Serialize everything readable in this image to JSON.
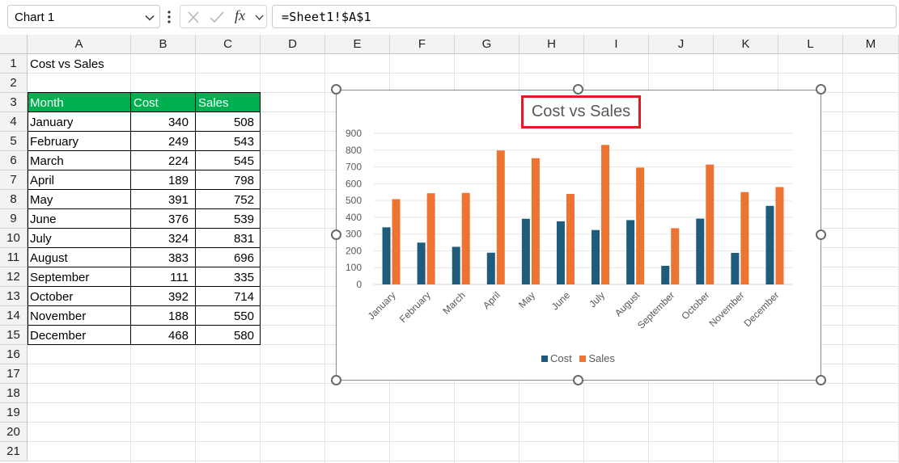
{
  "name_box": {
    "value": "Chart 1"
  },
  "formula_bar": {
    "formula": "=Sheet1!$A$1",
    "fx_label": "fx"
  },
  "columns": [
    "A",
    "B",
    "C",
    "D",
    "E",
    "F",
    "G",
    "H",
    "I",
    "J",
    "K",
    "L",
    "M"
  ],
  "rows": [
    "1",
    "2",
    "3",
    "4",
    "5",
    "6",
    "7",
    "8",
    "9",
    "10",
    "11",
    "12",
    "13",
    "14",
    "15",
    "16",
    "17",
    "18",
    "19",
    "20",
    "21"
  ],
  "sheet": {
    "a1": "Cost vs Sales",
    "header": {
      "month": "Month",
      "cost": "Cost",
      "sales": "Sales"
    },
    "data": [
      {
        "month": "January",
        "cost": "340",
        "sales": "508"
      },
      {
        "month": "February",
        "cost": "249",
        "sales": "543"
      },
      {
        "month": "March",
        "cost": "224",
        "sales": "545"
      },
      {
        "month": "April",
        "cost": "189",
        "sales": "798"
      },
      {
        "month": "May",
        "cost": "391",
        "sales": "752"
      },
      {
        "month": "June",
        "cost": "376",
        "sales": "539"
      },
      {
        "month": "July",
        "cost": "324",
        "sales": "831"
      },
      {
        "month": "August",
        "cost": "383",
        "sales": "696"
      },
      {
        "month": "September",
        "cost": "111",
        "sales": "335"
      },
      {
        "month": "October",
        "cost": "392",
        "sales": "714"
      },
      {
        "month": "November",
        "cost": "188",
        "sales": "550"
      },
      {
        "month": "December",
        "cost": "468",
        "sales": "580"
      }
    ],
    "header_color": "#00b050"
  },
  "chart_data": {
    "type": "bar",
    "title": "Cost vs Sales",
    "categories": [
      "January",
      "February",
      "March",
      "April",
      "May",
      "June",
      "July",
      "August",
      "September",
      "October",
      "November",
      "December"
    ],
    "series": [
      {
        "name": "Cost",
        "color": "#1f5c7c",
        "values": [
          340,
          249,
          224,
          189,
          391,
          376,
          324,
          383,
          111,
          392,
          188,
          468
        ]
      },
      {
        "name": "Sales",
        "color": "#ec7331",
        "values": [
          508,
          543,
          545,
          798,
          752,
          539,
          831,
          696,
          335,
          714,
          550,
          580
        ]
      }
    ],
    "yticks": [
      "0",
      "100",
      "200",
      "300",
      "400",
      "500",
      "600",
      "700",
      "800",
      "900"
    ],
    "ylim": [
      0,
      900
    ],
    "grid": true,
    "legend": "bottom",
    "title_highlight_color": "#e21b24"
  }
}
